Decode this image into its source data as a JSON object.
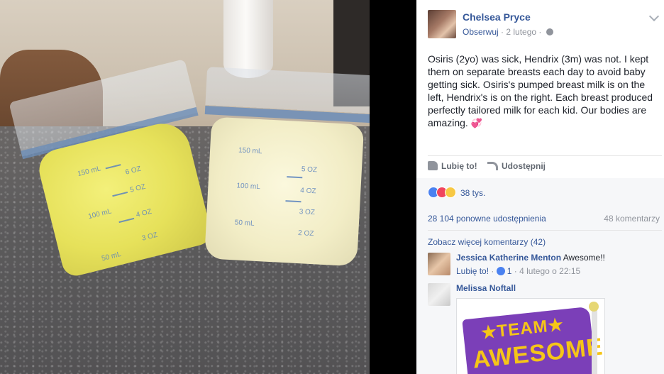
{
  "post": {
    "author": "Chelsea Pryce",
    "follow_label": "Obserwuj",
    "date": "2 lutego",
    "body": "Osiris (2yo) was sick, Hendrix (3m) was not. I kept them on separate breasts each day to avoid baby getting sick. Osiris's pumped breast milk is on the left, Hendrix's is on the right. Each breast produced perfectly tailored milk for each kid. Our bodies are amazing.",
    "emoji": "💞"
  },
  "actions": {
    "like_label": "Lubię to!",
    "share_label": "Udostępnij"
  },
  "stats": {
    "reactions_count": "38 tys.",
    "shares": "28 104 ponowne udostępnienia",
    "comments": "48 komentarzy",
    "more_comments": "Zobacz więcej komentarzy (42)"
  },
  "comments": [
    {
      "name": "Jessica Katherine Menton",
      "text": "Awesome!!",
      "like_label": "Lubię to!",
      "likes": "1",
      "time": "4 lutego o 22:15"
    },
    {
      "name": "Melissa Noftall",
      "text": ""
    }
  ],
  "photo": {
    "scale_left": [
      "150 mL",
      "100 mL",
      "50 mL"
    ],
    "scale_left_oz": [
      "6 OZ",
      "5 OZ",
      "4 OZ",
      "3 OZ"
    ],
    "scale_right": [
      "150 mL",
      "100 mL",
      "50 mL"
    ],
    "scale_right_oz": [
      "5 OZ",
      "4 OZ",
      "3 OZ",
      "2 OZ"
    ]
  },
  "sticker": {
    "line1": "★TEAM★",
    "line2": "AWESOME"
  },
  "colors": {
    "link": "#365899",
    "muted": "#90949c",
    "text": "#1d2129",
    "like_blue": "#4a81f0",
    "love_red": "#f0455e",
    "wow_yellow": "#f7c844"
  }
}
